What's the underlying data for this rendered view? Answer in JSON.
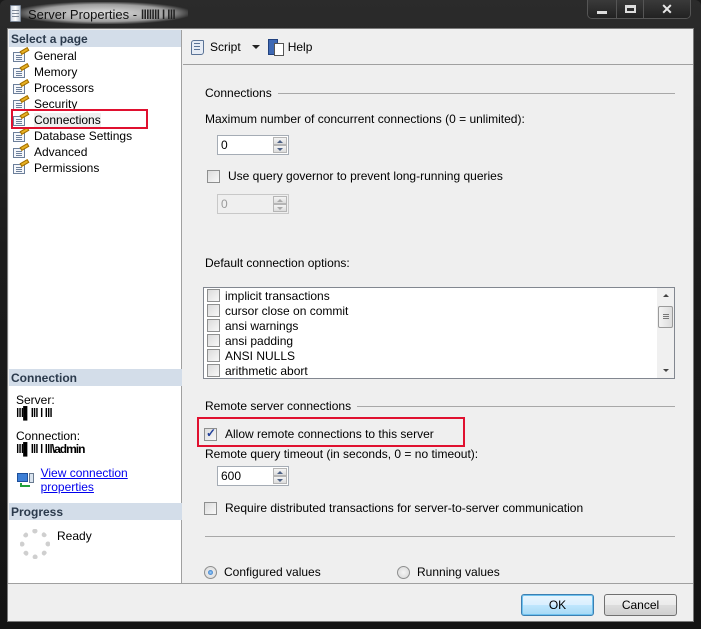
{
  "window": {
    "title": "Server Properties - ",
    "title_server": "ǀǀǀǀǀǀǀ ǀ ǀǀǀ",
    "icon": "server-icon",
    "controls": [
      "minimize",
      "maximize",
      "close"
    ]
  },
  "sidebar": {
    "header": "Select a page",
    "pages": [
      {
        "label": "General",
        "icon": "page-wand-icon"
      },
      {
        "label": "Memory",
        "icon": "page-wand-icon"
      },
      {
        "label": "Processors",
        "icon": "page-wand-icon"
      },
      {
        "label": "Security",
        "icon": "page-wand-icon"
      },
      {
        "label": "Connections",
        "icon": "page-wand-icon",
        "selected": true
      },
      {
        "label": "Database Settings",
        "icon": "page-wand-icon"
      },
      {
        "label": "Advanced",
        "icon": "page-wand-icon"
      },
      {
        "label": "Permissions",
        "icon": "page-wand-icon"
      }
    ],
    "connection": {
      "header": "Connection",
      "server_label": "Server:",
      "server_value": "ǀǀǀ▌ǀǀǀ ǀ ǀǀǀ",
      "connection_label": "Connection:",
      "connection_value": "ǀǀǀ▌ǀǀǀ ǀ ǀǀǀ\\admin",
      "link": "View connection properties"
    },
    "progress": {
      "header": "Progress",
      "status": "Ready"
    }
  },
  "toolbar": {
    "script_label": "Script",
    "help_label": "Help"
  },
  "connections": {
    "group_title": "Connections",
    "max_label": "Maximum number of concurrent connections (0 = unlimited):",
    "max_value": "0",
    "governor_label": "Use query governor to prevent long-running queries",
    "governor_checked": false,
    "governor_value": "0",
    "defaults_label": "Default connection options:",
    "options": [
      {
        "label": "implicit transactions",
        "checked": false
      },
      {
        "label": "cursor close on commit",
        "checked": false
      },
      {
        "label": "ansi warnings",
        "checked": false
      },
      {
        "label": "ansi padding",
        "checked": false
      },
      {
        "label": "ANSI NULLS",
        "checked": false
      },
      {
        "label": "arithmetic abort",
        "checked": false
      }
    ]
  },
  "remote": {
    "group_title": "Remote server connections",
    "allow_label": "Allow remote connections to this server",
    "allow_checked": true,
    "timeout_label": "Remote query timeout (in seconds, 0 = no timeout):",
    "timeout_value": "600",
    "distributed_label": "Require distributed transactions for server-to-server communication",
    "distributed_checked": false
  },
  "values_mode": {
    "configured_label": "Configured values",
    "running_label": "Running values",
    "selected": "configured"
  },
  "footer": {
    "ok_label": "OK",
    "cancel_label": "Cancel"
  },
  "colors": {
    "highlight": "#e0102f",
    "section_header_bg": "#d3dde9",
    "link": "#0000ee"
  }
}
